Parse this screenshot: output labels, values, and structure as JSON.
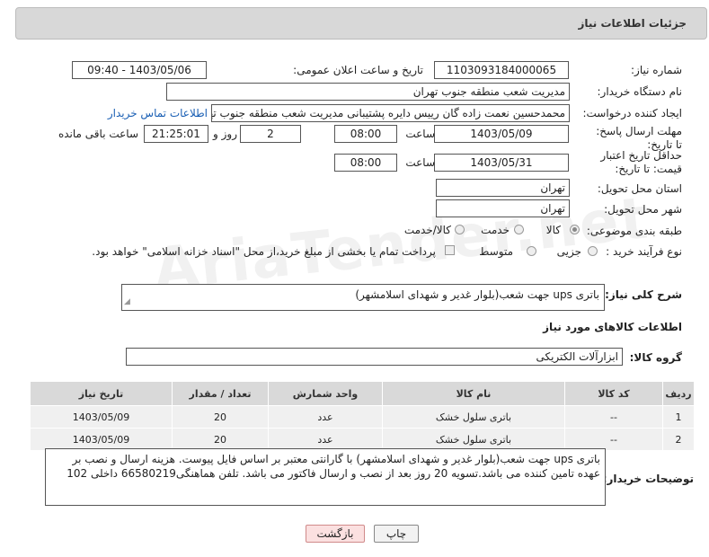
{
  "header": {
    "title": "جزئیات اطلاعات نیاز"
  },
  "form": {
    "need_number_label": "شماره نیاز:",
    "need_number": "1103093184000065",
    "announce_label": "تاریخ و ساعت اعلان عمومی:",
    "announce_value": "1403/05/06 - 09:40",
    "buyer_org_label": "نام دستگاه خریدار:",
    "buyer_org": "مدیریت شعب منطقه جنوب تهران",
    "creator_label": "ایجاد کننده درخواست:",
    "creator": "محمدحسین نعمت زاده گان رییس دایره پشتیبانی مدیریت شعب منطقه جنوب تهران",
    "contact_link": "اطلاعات تماس خریدار",
    "reply_deadline_label": "مهلت ارسال پاسخ: تا تاریخ:",
    "reply_date": "1403/05/09",
    "time_label": "ساعت",
    "reply_time": "08:00",
    "days_value": "2",
    "days_label": "روز و",
    "remaining_time": "21:25:01",
    "remaining_label": "ساعت باقی مانده",
    "price_validity_label": "حداقل تاریخ اعتبار قیمت: تا تاریخ:",
    "price_date": "1403/05/31",
    "price_time": "08:00",
    "province_label": "استان محل تحویل:",
    "province": "تهران",
    "city_label": "شهر محل تحویل:",
    "city": "تهران",
    "category_label": "طبقه بندی موضوعی:",
    "category_options": [
      "کالا",
      "خدمت",
      "کالا/خدمت"
    ],
    "process_label": "نوع فرآیند خرید :",
    "process_options": [
      "جزیی",
      "متوسط"
    ],
    "payment_note": "پرداخت تمام یا بخشی از مبلغ خرید،از محل \"اسناد خزانه اسلامی\" خواهد بود."
  },
  "description": {
    "label": "شرح کلی نیاز:",
    "value": "باتری ups جهت شعب(بلوار غدیر و شهدای اسلامشهر)"
  },
  "goods_section": {
    "title": "اطلاعات کالاهای مورد نیاز",
    "group_label": "گروه کالا:",
    "group_value": "ابزارآلات الکتریکی"
  },
  "table": {
    "headers": [
      "ردیف",
      "کد کالا",
      "نام کالا",
      "واحد شمارش",
      "تعداد / مقدار",
      "تاریخ نیاز"
    ],
    "rows": [
      [
        "1",
        "--",
        "باتری سلول خشک",
        "عدد",
        "20",
        "1403/05/09"
      ],
      [
        "2",
        "--",
        "باتری سلول خشک",
        "عدد",
        "20",
        "1403/05/09"
      ]
    ]
  },
  "buyer_notes": {
    "label": "توضیحات خریدار:",
    "value": "باتری ups جهت شعب(بلوار غدیر و شهدای اسلامشهر) با گارانتی معتبر بر اساس فایل پیوست. هزینه ارسال و نصب بر عهده تامین کننده می باشد.تسویه 20 روز بعد از نصب و ارسال فاکتور می باشد. تلفن هماهنگی66580219 داخلی 102"
  },
  "buttons": {
    "print": "چاپ",
    "back": "بازگشت"
  },
  "watermark": "AriaTender.net",
  "colors": {
    "back_button_bg": "#fbe0e0",
    "back_button_border": "#d08a8a",
    "link": "#1a5fb4"
  }
}
